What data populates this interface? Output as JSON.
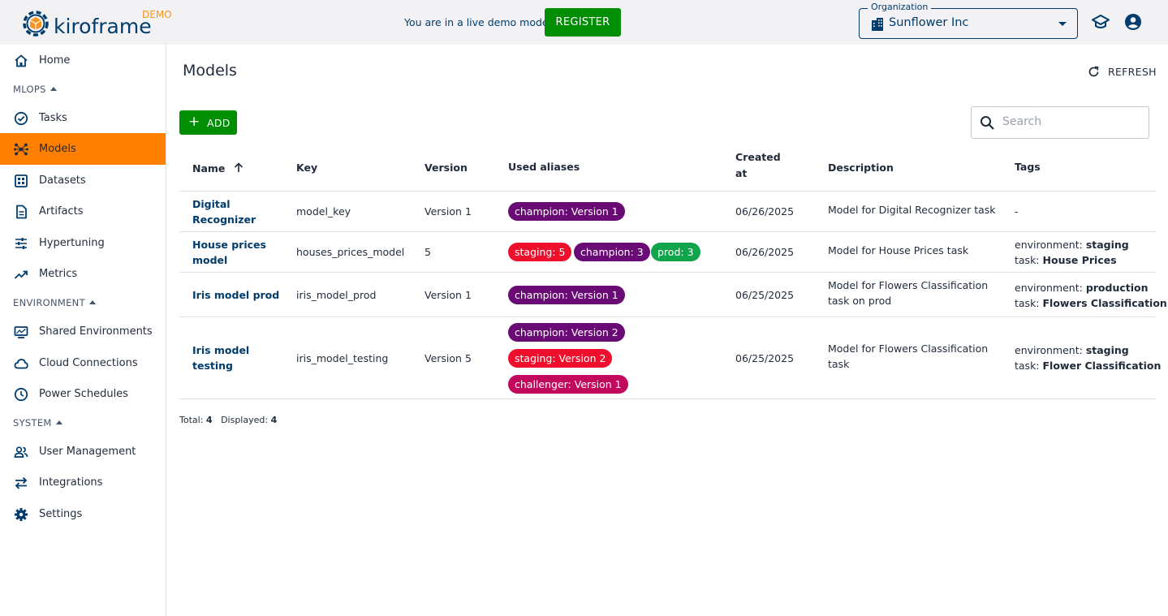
{
  "header": {
    "logo_text": "kiroframe",
    "logo_badge": "DEMO",
    "demo_message": "You are in a live demo mode",
    "register_label": "REGISTER",
    "org_label": "Organization",
    "org_value": "Sunflower Inc",
    "colors": {
      "brand": "#003c6c",
      "accent": "#ff8000",
      "success": "#018e05"
    }
  },
  "sidebar": {
    "home": "Home",
    "sections": {
      "mlops": "MLOPS",
      "environment": "ENVIRONMENT",
      "system": "SYSTEM"
    },
    "items": {
      "tasks": "Tasks",
      "models": "Models",
      "datasets": "Datasets",
      "artifacts": "Artifacts",
      "hypertuning": "Hypertuning",
      "metrics": "Metrics",
      "shared_environments": "Shared Environments",
      "cloud_connections": "Cloud Connections",
      "power_schedules": "Power Schedules",
      "user_management": "User Management",
      "integrations": "Integrations",
      "settings": "Settings"
    }
  },
  "main": {
    "title": "Models",
    "refresh_label": "REFRESH",
    "add_label": "ADD",
    "search_placeholder": "Search",
    "columns": {
      "name": "Name",
      "key": "Key",
      "version": "Version",
      "aliases": "Used aliases",
      "created_line1": "Created",
      "created_line2": "at",
      "description": "Description",
      "tags": "Tags"
    },
    "rows": [
      {
        "name_l1": "Digital",
        "name_l2": "Recognizer",
        "key": "model_key",
        "version": "Version 1",
        "aliases": [
          "champion: Version 1"
        ],
        "created": "06/26/2025",
        "desc_l1": "Model for Digital Recognizer task",
        "desc_l2": "",
        "tags_dash": "-"
      },
      {
        "name_l1": "House prices",
        "name_l2": "model",
        "key": "houses_prices_model",
        "version": "5",
        "aliases": [
          "staging: 5",
          "champion: 3",
          "prod: 3"
        ],
        "created": "06/26/2025",
        "desc_l1": "Model for House Prices task",
        "desc_l2": "",
        "tag1_key": "environment:",
        "tag1_val": "staging",
        "tag2_key": "task:",
        "tag2_val": "House Prices"
      },
      {
        "name_l1": "Iris model prod",
        "name_l2": "",
        "key": "iris_model_prod",
        "version": "Version 1",
        "aliases": [
          "champion: Version 1"
        ],
        "created": "06/25/2025",
        "desc_l1": "Model for Flowers Classification",
        "desc_l2": "task on prod",
        "tag1_key": "environment:",
        "tag1_val": "production",
        "tag2_key": "task:",
        "tag2_val": "Flowers Classification"
      },
      {
        "name_l1": "Iris model",
        "name_l2": "testing",
        "key": "iris_model_testing",
        "version": "Version 5",
        "aliases": [
          "champion: Version 2",
          "staging: Version 2",
          "challenger: Version 1"
        ],
        "created": "06/25/2025",
        "desc_l1": "Model for Flowers Classification",
        "desc_l2": "task",
        "tag1_key": "environment:",
        "tag1_val": "staging",
        "tag2_key": "task:",
        "tag2_val": "Flower Classification"
      }
    ],
    "alias_colors": {
      "champion": "#6a0a75",
      "staging": "#ef0f2d",
      "prod": "#10a54a",
      "challenger": "#c2095e"
    },
    "totals": {
      "total_label": "Total:",
      "total_value": "4",
      "displayed_label": "Displayed:",
      "displayed_value": "4"
    }
  }
}
